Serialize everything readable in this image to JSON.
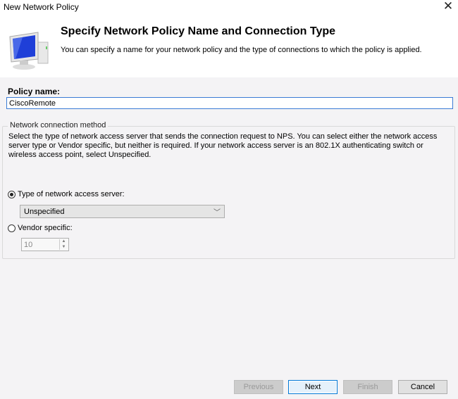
{
  "window": {
    "title": "New Network Policy",
    "close_icon": "close-icon"
  },
  "header": {
    "icon": "computer-monitor-icon",
    "title": "Specify Network Policy Name and Connection Type",
    "subtitle": "You can specify a name for your network policy and the type of connections to which the policy is applied."
  },
  "policy_name": {
    "label": "Policy name:",
    "value": "CiscoRemote"
  },
  "connection_method": {
    "group_label": "Network connection method",
    "description": "Select the type of network access server that sends the connection request to NPS. You can select either the network access server type or Vendor specific, but neither is required.  If your network access server is an 802.1X authenticating switch or wireless access point, select Unspecified.",
    "option_type": {
      "label": "Type of network access server:",
      "checked": true,
      "selected_value": "Unspecified"
    },
    "option_vendor": {
      "label": "Vendor specific:",
      "checked": false,
      "value": "10"
    }
  },
  "footer": {
    "previous": "Previous",
    "next": "Next",
    "finish": "Finish",
    "cancel": "Cancel"
  }
}
